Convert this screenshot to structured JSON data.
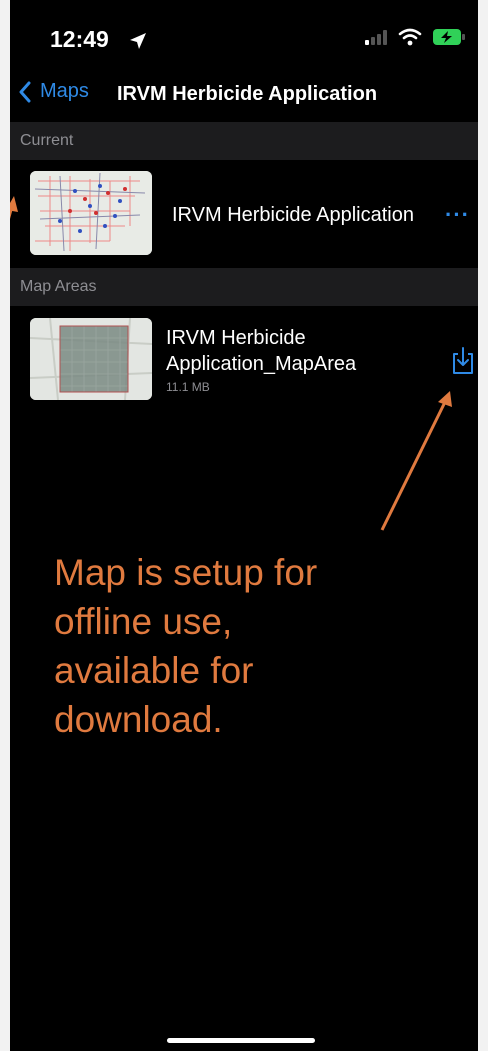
{
  "status_bar": {
    "time": "12:49"
  },
  "nav": {
    "back_label": "Maps",
    "title": "IRVM Herbicide Application"
  },
  "sections": {
    "current": {
      "header": "Current",
      "item": {
        "title": "IRVM Herbicide Application",
        "more_label": "···"
      }
    },
    "map_areas": {
      "header": "Map Areas",
      "item": {
        "title_line1": "IRVM Herbicide",
        "title_line2": "Application_MapArea",
        "size": "11.1 MB"
      }
    }
  },
  "annotation": {
    "text_line1": "Map is setup for",
    "text_line2": "offline use,",
    "text_line3": "available for",
    "text_line4": "download.",
    "color": "#e07a3f"
  },
  "colors": {
    "accent": "#2f8ae6",
    "background": "#000000",
    "section_header": "#1c1c1e"
  },
  "icons": [
    "location-arrow-icon",
    "signal-icon",
    "wifi-icon",
    "battery-charging-icon",
    "chevron-left-icon",
    "more-icon",
    "download-icon",
    "map-thumbnail"
  ]
}
